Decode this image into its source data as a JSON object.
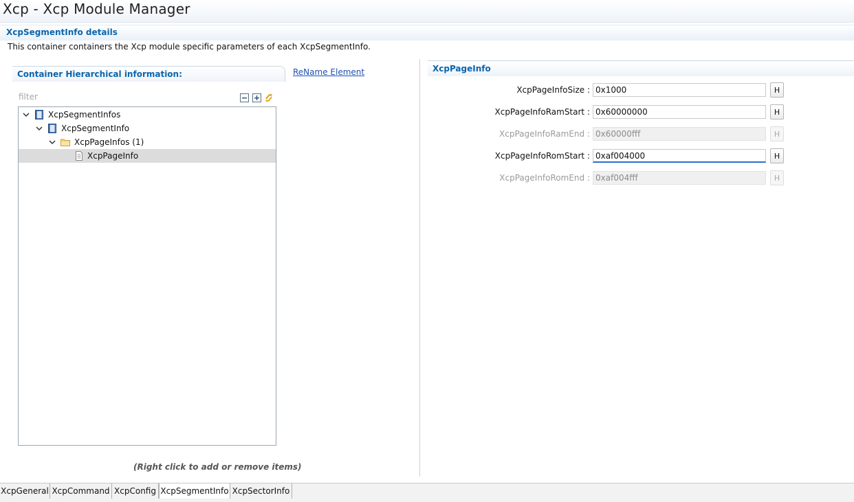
{
  "window": {
    "title": "Xcp - Xcp Module Manager"
  },
  "section": {
    "title": "XcpSegmentInfo details",
    "description": "This container containers the Xcp module specific parameters of each XcpSegmentInfo."
  },
  "left_panel": {
    "title": "Container Hierarchical information:",
    "rename_label": "ReName Element",
    "filter_placeholder": "filter",
    "toolbar": {
      "collapse_icon": "collapse-all-icon",
      "expand_icon": "expand-all-icon",
      "sync_icon": "sync-icon"
    },
    "tree": [
      {
        "label": "XcpSegmentInfos",
        "icon": "container-icon",
        "expanded": true,
        "level": 0
      },
      {
        "label": "XcpSegmentInfo",
        "icon": "container-icon",
        "expanded": true,
        "level": 1
      },
      {
        "label": "XcpPageInfos (1)",
        "icon": "folder-icon",
        "expanded": true,
        "level": 2
      },
      {
        "label": "XcpPageInfo",
        "icon": "document-icon",
        "selected": true,
        "level": 3
      }
    ],
    "hint": "(Right click to add or remove items)"
  },
  "right_panel": {
    "title": "XcpPageInfo",
    "params": [
      {
        "label": "XcpPageInfoSize :",
        "value": "0x1000",
        "enabled": true,
        "button": "H"
      },
      {
        "label": "XcpPageInfoRamStart :",
        "value": "0x60000000",
        "enabled": true,
        "button": "H"
      },
      {
        "label": "XcpPageInfoRamEnd :",
        "value": "0x60000fff",
        "enabled": false,
        "button": "H"
      },
      {
        "label": "XcpPageInfoRomStart :",
        "value": "0xaf004000",
        "enabled": true,
        "focused": true,
        "button": "H"
      },
      {
        "label": "XcpPageInfoRomEnd :",
        "value": "0xaf004fff",
        "enabled": false,
        "button": "H"
      }
    ]
  },
  "tabs": [
    {
      "label": "XcpGeneral",
      "active": false
    },
    {
      "label": "XcpCommand",
      "active": false
    },
    {
      "label": "XcpConfig",
      "active": false
    },
    {
      "label": "XcpSegmentInfo",
      "active": true
    },
    {
      "label": "XcpSectorInfo",
      "active": false
    }
  ],
  "colors": {
    "accent": "#0a64ad",
    "link": "#1f4fb0",
    "selection": "#dcdcdc"
  }
}
